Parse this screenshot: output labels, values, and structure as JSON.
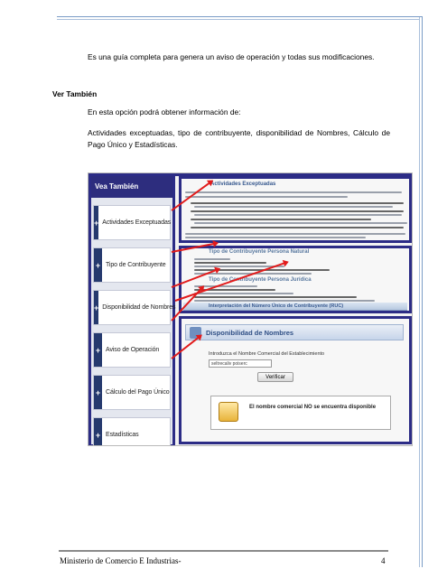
{
  "intro": "Es una guía completa para genera un aviso de operación y todas sus modificaciones.",
  "section_heading": "Ver También",
  "section_subtitle": "En esta opción podrá obtener información de:",
  "section_paragraph": "Actividades exceptuadas, tipo de contribuyente, disponibilidad de Nombres, Cálculo de Pago Único y Estadísticas.",
  "screenshot": {
    "sidebar_title": "Vea También",
    "sidebar_items": [
      "Actividades Exceptuadas",
      "Tipo de Contribuyente",
      "Disponibilidad de Nombres",
      "Aviso de Operación",
      "Cálculo del Pago Único",
      "Estadísticas"
    ],
    "panel1_title": "Actividades Exceptuadas",
    "panel2_title": "Tipo de Contribuyente Persona Natural",
    "panel2_subtitle": "Tipo de Contribuyente Persona Jurídica",
    "panel2_footer": "Interpretación del Número Único de Contribuyente (RUC)",
    "names_title": "Disponibilidad de Nombres",
    "names_label": "Introduzca el Nombre Comercial del Establecimiento",
    "names_value": "seltrecaliv poiserc",
    "names_button": "Verificar",
    "names_message": "El nombre comercial NO se encuentra disponible"
  },
  "footer": {
    "left": "Ministerio de Comercio E Industrias-",
    "page_number": "4"
  }
}
